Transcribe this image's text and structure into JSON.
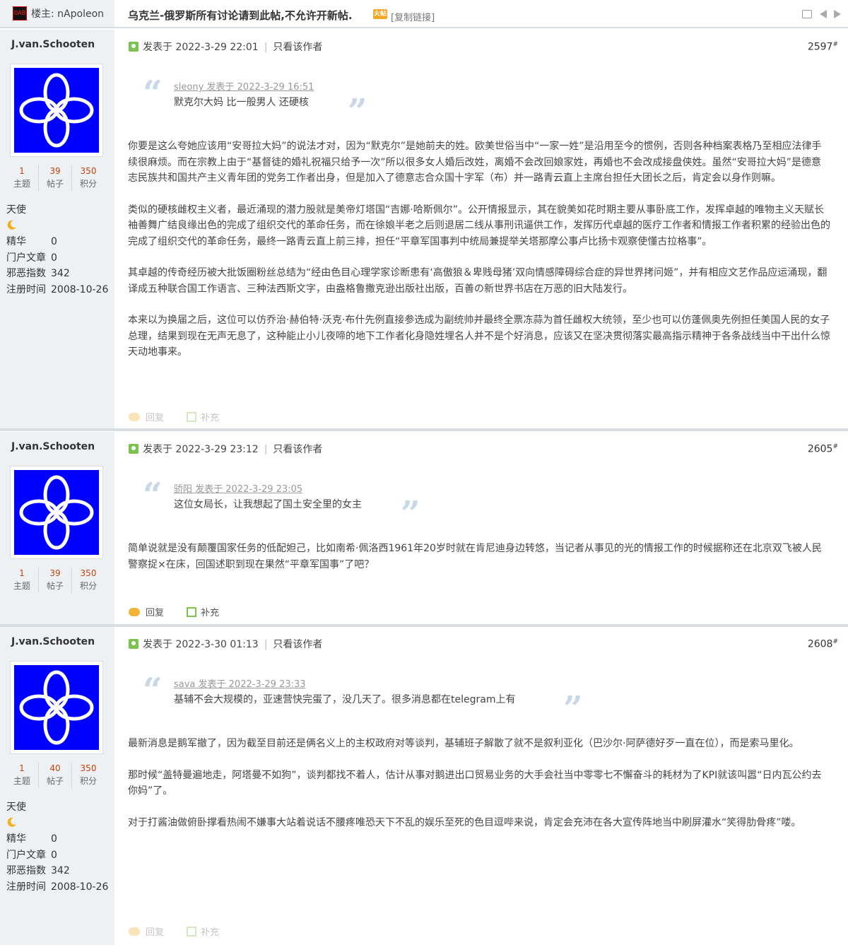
{
  "header": {
    "owner_label": "楼主: nApoleon",
    "thread_title": "乌克兰-俄罗斯所有讨论请到此帖,不允许开新帖.",
    "hot_badge": "火帖",
    "copy_link": "[复制链接]"
  },
  "labels": {
    "posted_at_prefix": "发表于",
    "only_author": "只看该作者",
    "reply": "回复",
    "supplement": "补充",
    "topics": "主题",
    "posts": "帖子",
    "points": "积分",
    "essence": "精华",
    "portal_articles": "门户文章",
    "evil_index": "邪恶指数",
    "register_time": "注册时间"
  },
  "posts": [
    {
      "author": "J.van.Schooten",
      "topics": "1",
      "post_count": "39",
      "points": "350",
      "rank": "天使",
      "essence": "0",
      "portal_articles": "0",
      "evil_index": "342",
      "register_time": "2008-10-26",
      "posted_at": "2022-3-29 22:01",
      "floor": "2597",
      "quote_source": "sleony 发表于 2022-3-29 16:51",
      "quote_text": "默克尔大妈  比一般男人 还硬核",
      "paragraphs": [
        "你要是这么夸她应该用“安哥拉大妈”的说法才对，因为“默克尔”是她前夫的姓。欧美世俗当中“一家一姓”是沿用至今的惯例，否则各种档案表格乃至相应法律手续很麻烦。而在宗教上由于“基督徒的婚礼祝福只给予一次”所以很多女人婚后改姓，离婚不会改回娘家姓，再婚也不会改成接盘侠姓。虽然“安哥拉大妈”是德意志民族共和国共产主义青年团的党务工作者出身，但是加入了德意志合众国十字军（布）并一路青云直上主席台担任大团长之后，肯定会以身作则嘛。",
        "类似的硬核雌权主义者，最近涌现的潜力股就是美帝灯塔国“吉娜·哈斯佩尔”。公开情报显示，其在貌美如花时期主要从事卧底工作，发挥卓越的唯物主义天赋长袖善舞广结良缘出色的完成了组织交代的革命任务，而在徐娘半老之后则退居二线从事刑讯逼供工作，发挥历代卓越的医疗工作者和情报工作者积累的经验出色的完成了组织交代的革命任务，最终一路青云直上前三排，担任“平章军国事判中统局兼提举关塔那摩公事卢比扬卡观察使懂古拉格事”。",
        "其卓越的传奇经历被大批饭圈粉丝总结为“经由色目心理学家诊断患有‘高傲狼＆卑贱母猪’双向情感障碍综合症的异世界拷问姬”，并有相应文艺作品应运涌现，翻译成五种联合国工作语言、三种法西斯文字，由盎格鲁撒克逊出版社出版，百善の新世界书店在万恶的旧大陆发行。",
        "本来以为换届之后，这位可以仿乔治·赫伯特·沃克·布什先例直接参选成为副统帅并最终全票冻蒜为首任雌权大统领，至少也可以仿蓬佩奥先例担任美国人民的女子总理，结果到现在无声无息了，这种能止小儿夜啼的地下工作者化身隐姓埋名人并不是个好消息，应该又在坚决贯彻落实最高指示精神于各条战线当中干出什么惊天动地事来。"
      ]
    },
    {
      "author": "J.van.Schooten",
      "topics": "1",
      "post_count": "39",
      "points": "350",
      "posted_at": "2022-3-29 23:12",
      "floor": "2605",
      "quote_source": "骄阳 发表于 2022-3-29 23:05",
      "quote_text": "这位女局长，让我想起了国土安全里的女主",
      "paragraphs": [
        "简单说就是没有颠覆国家任务的低配妲己，比如南希·佩洛西1961年20岁时就在肯尼迪身边转悠，当记者从事见的光的情报工作的时候据称还在北京双飞被人民警察捉×在床，回国述职到现在果然“平章军国事”了吧？"
      ]
    },
    {
      "author": "J.van.Schooten",
      "topics": "1",
      "post_count": "40",
      "points": "350",
      "rank": "天使",
      "essence": "0",
      "portal_articles": "0",
      "evil_index": "342",
      "register_time": "2008-10-26",
      "posted_at": "2022-3-30 01:13",
      "floor": "2608",
      "quote_source": "sava 发表于 2022-3-29 23:33",
      "quote_text": "基辅不会大规模的，亚速营快完蛋了，没几天了。很多消息都在telegram上有",
      "paragraphs": [
        "最新消息是鹅军撤了，因为截至目前还是俩名义上的主权政府对等谈判，基辅班子解散了就不是叙利亚化（巴沙尔·阿萨德好歹一直在位），而是索马里化。",
        "那时候“盖特曼遍地走，阿塔曼不如狗”，谈判都找不着人，估计从事对鹅进出口贸易业务的大手会社当中零零七不懈奋斗的耗材为了KPI就该叫嚣“日内瓦公约去你妈”了。",
        "对于打酱油做俯卧撑看热闹不嫌事大站着说话不腰疼唯恐天下不乱的娱乐至死的色目逗哔来说，肯定会充沛在各大宣传阵地当中刷屏灌水“笑得肋骨疼”喽。"
      ]
    }
  ],
  "colors": {
    "sidebar_bg": "#eef1f4",
    "avatar_blue": "#0000ff",
    "stat_number": "#c2440c",
    "quote_mark": "#c8d8e8"
  }
}
